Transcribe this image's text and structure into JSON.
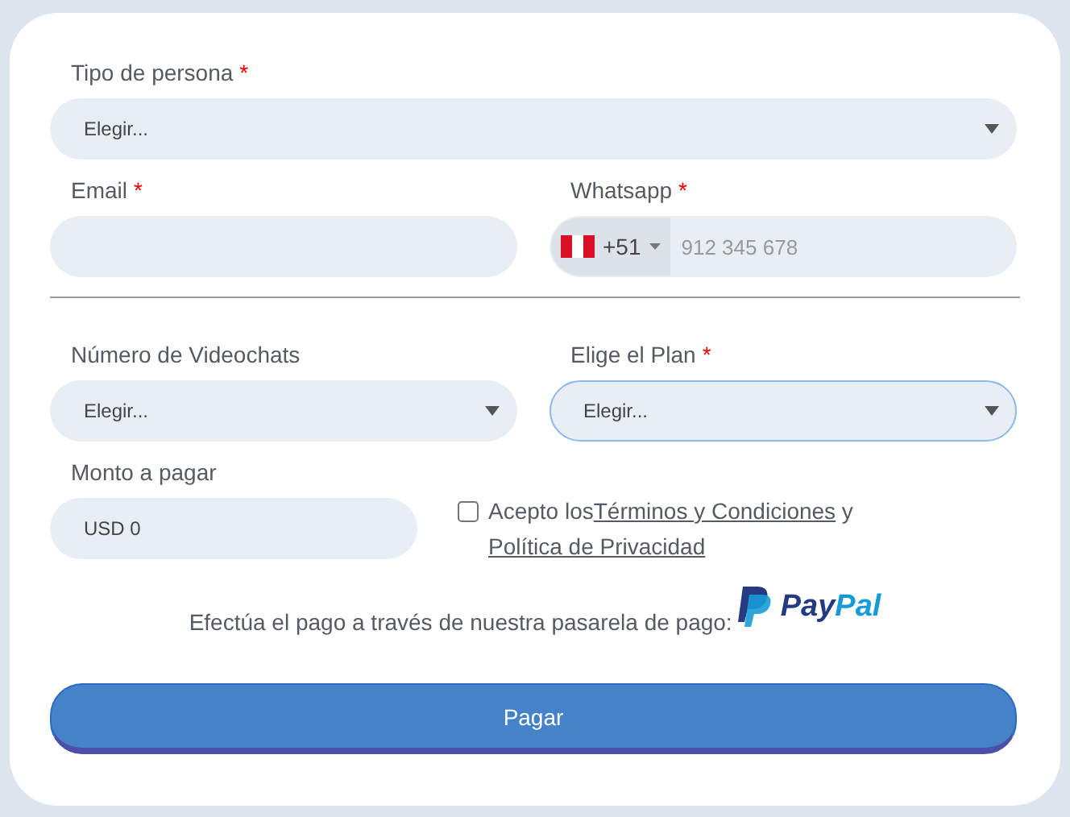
{
  "sections": [
    {
      "rows": [
        [
          {
            "kind": "select",
            "label": "Tipo de persona",
            "required_mark": "*",
            "value": "Elegir...",
            "focused": false
          }
        ],
        [
          {
            "kind": "text",
            "label": "Email",
            "required_mark": "*",
            "focused": false
          },
          {
            "kind": "phone",
            "label": "Whatsapp",
            "required_mark": "*",
            "country_code": "+51",
            "placeholder": "912 345 678",
            "focused": false
          }
        ]
      ]
    },
    {
      "rows": [
        [
          {
            "kind": "select",
            "label": "Número de Videochats",
            "value": "Elegir...",
            "focused": false
          },
          {
            "kind": "select",
            "label": "Elige el Plan",
            "required_mark": "*",
            "value": "Elegir...",
            "focused": true
          }
        ],
        [
          {
            "kind": "text",
            "label": "Monto a pagar",
            "value": "USD 0",
            "focused": false
          },
          {
            "kind": "consent",
            "checked": false,
            "prefix": "Acepto los",
            "link_1": "Términos y Condiciones",
            "middle": "y",
            "link_2": "Política de Privacidad"
          }
        ]
      ]
    }
  ],
  "payment": {
    "text": "Efectúa el pago a través de nuestra pasarela de pago:",
    "logo_text_1": "Pay",
    "logo_text_2": "Pal"
  },
  "submit_button": "Pagar"
}
